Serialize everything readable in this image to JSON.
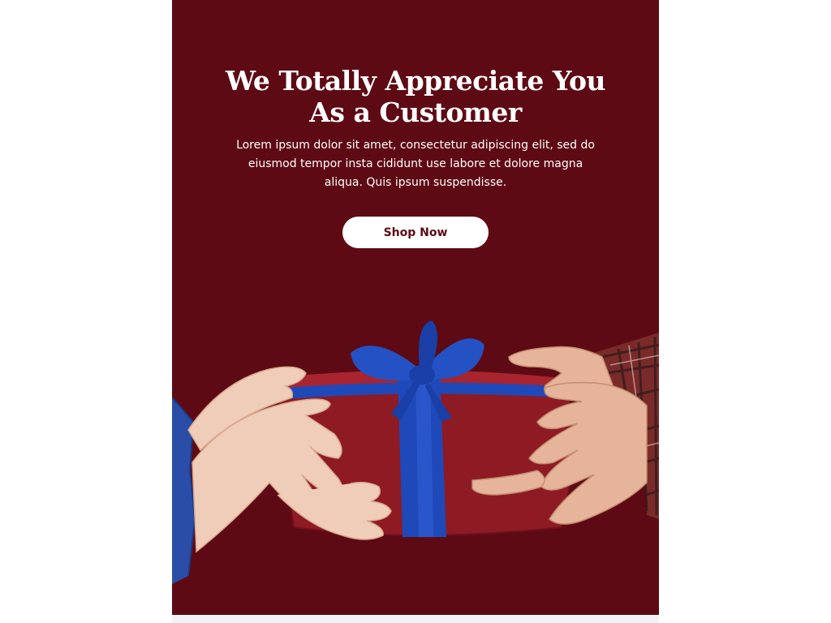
{
  "hero": {
    "headline_line1": "We Totally Appreciate You",
    "headline_line2": "As a Customer",
    "body": "Lorem ipsum dolor sit amet, consectetur adipiscing elit, sed do eiusmod tempor insta cididunt use labore et dolore magna aliqua. Quis ipsum suspendisse.",
    "cta_label": "Shop Now"
  },
  "colors": {
    "background": "#5e0a14",
    "button_bg": "#ffffff",
    "button_text": "#5e0a14",
    "gift_box": "#8e1a24",
    "ribbon": "#1f49b8"
  },
  "image": {
    "icon": "gift-exchange-illustration"
  }
}
